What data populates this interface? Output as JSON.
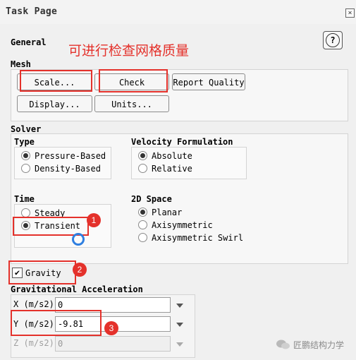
{
  "window": {
    "title": "Task Page",
    "close_glyph": "×"
  },
  "general": {
    "label": "General",
    "help_glyph": "?"
  },
  "annotation": "可进行检查网格质量",
  "mesh": {
    "label": "Mesh",
    "scale_label": "Scale...",
    "check_label": "Check",
    "report_label": "Report Quality",
    "display_label": "Display...",
    "units_label": "Units..."
  },
  "solver": {
    "label": "Solver",
    "type": {
      "label": "Type",
      "options": [
        "Pressure-Based",
        "Density-Based"
      ],
      "selected": "Pressure-Based"
    },
    "velocity": {
      "label": "Velocity Formulation",
      "options": [
        "Absolute",
        "Relative"
      ],
      "selected": "Absolute"
    },
    "time": {
      "label": "Time",
      "options": [
        "Steady",
        "Transient"
      ],
      "selected": "Transient"
    },
    "space": {
      "label": "2D Space",
      "options": [
        "Planar",
        "Axisymmetric",
        "Axisymmetric Swirl"
      ],
      "selected": "Planar"
    }
  },
  "gravity": {
    "label": "Gravity",
    "checked": true
  },
  "accel": {
    "label": "Gravitational Acceleration",
    "x": {
      "label": "X (m/s2)",
      "value": "0"
    },
    "y": {
      "label": "Y (m/s2)",
      "value": "-9.81"
    },
    "z": {
      "label": "Z (m/s2)",
      "value": "0"
    }
  },
  "badges": [
    "1",
    "2",
    "3"
  ],
  "watermark": "匠鹏结构力学",
  "colors": {
    "annotation_red": "#e4312b",
    "spinner_blue": "#2f7fe0"
  }
}
